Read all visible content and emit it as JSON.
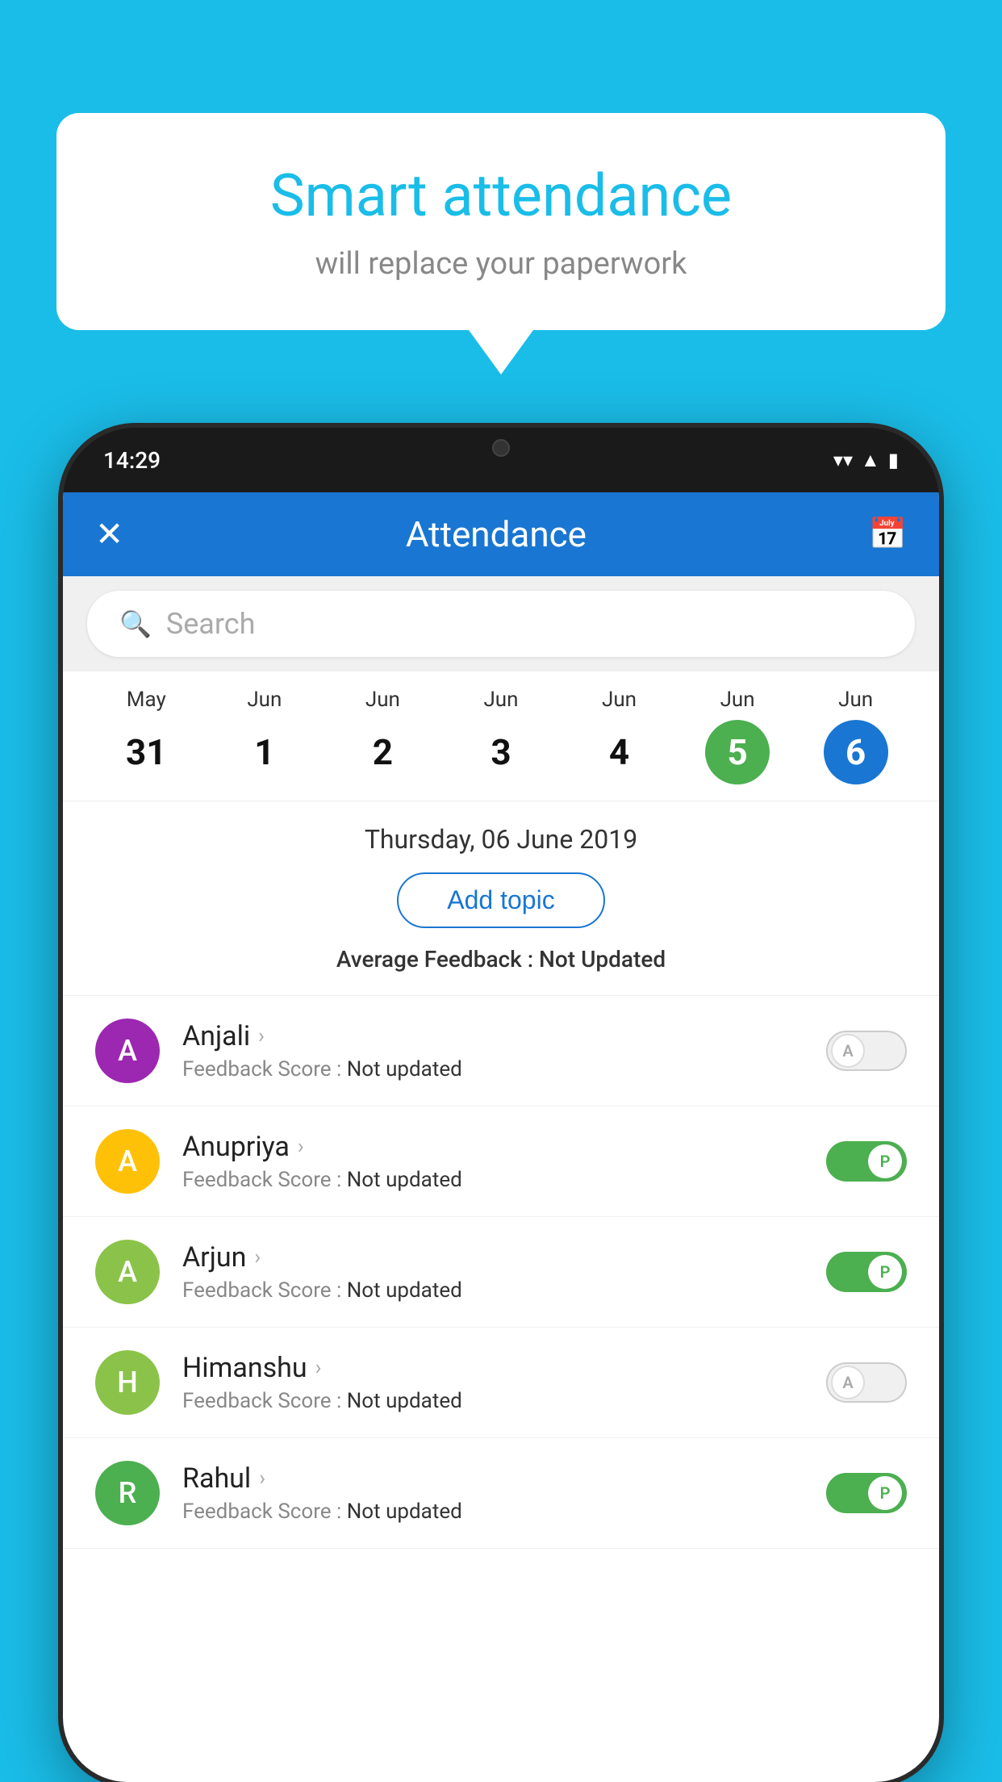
{
  "background_color": "#1ABDE8",
  "speech_bubble": {
    "title": "Smart attendance",
    "subtitle": "will replace your paperwork"
  },
  "phone": {
    "time": "14:29",
    "header": {
      "title": "Attendance",
      "close_label": "✕",
      "calendar_icon": "📅"
    },
    "search": {
      "placeholder": "Search"
    },
    "calendar": {
      "days": [
        {
          "month": "May",
          "num": "31",
          "state": "normal"
        },
        {
          "month": "Jun",
          "num": "1",
          "state": "normal"
        },
        {
          "month": "Jun",
          "num": "2",
          "state": "normal"
        },
        {
          "month": "Jun",
          "num": "3",
          "state": "normal"
        },
        {
          "month": "Jun",
          "num": "4",
          "state": "normal"
        },
        {
          "month": "Jun",
          "num": "5",
          "state": "today"
        },
        {
          "month": "Jun",
          "num": "6",
          "state": "selected"
        }
      ]
    },
    "date_label": "Thursday, 06 June 2019",
    "add_topic_label": "Add topic",
    "average_feedback_label": "Average Feedback :",
    "average_feedback_value": "Not Updated",
    "students": [
      {
        "name": "Anjali",
        "initial": "A",
        "avatar_color": "#9C27B0",
        "feedback": "Not updated",
        "toggle": "off",
        "toggle_label": "A"
      },
      {
        "name": "Anupriya",
        "initial": "A",
        "avatar_color": "#FFC107",
        "feedback": "Not updated",
        "toggle": "on",
        "toggle_label": "P"
      },
      {
        "name": "Arjun",
        "initial": "A",
        "avatar_color": "#8BC34A",
        "feedback": "Not updated",
        "toggle": "on",
        "toggle_label": "P"
      },
      {
        "name": "Himanshu",
        "initial": "H",
        "avatar_color": "#8BC34A",
        "feedback": "Not updated",
        "toggle": "off",
        "toggle_label": "A"
      },
      {
        "name": "Rahul",
        "initial": "R",
        "avatar_color": "#4CAF50",
        "feedback": "Not updated",
        "toggle": "on",
        "toggle_label": "P"
      }
    ]
  }
}
